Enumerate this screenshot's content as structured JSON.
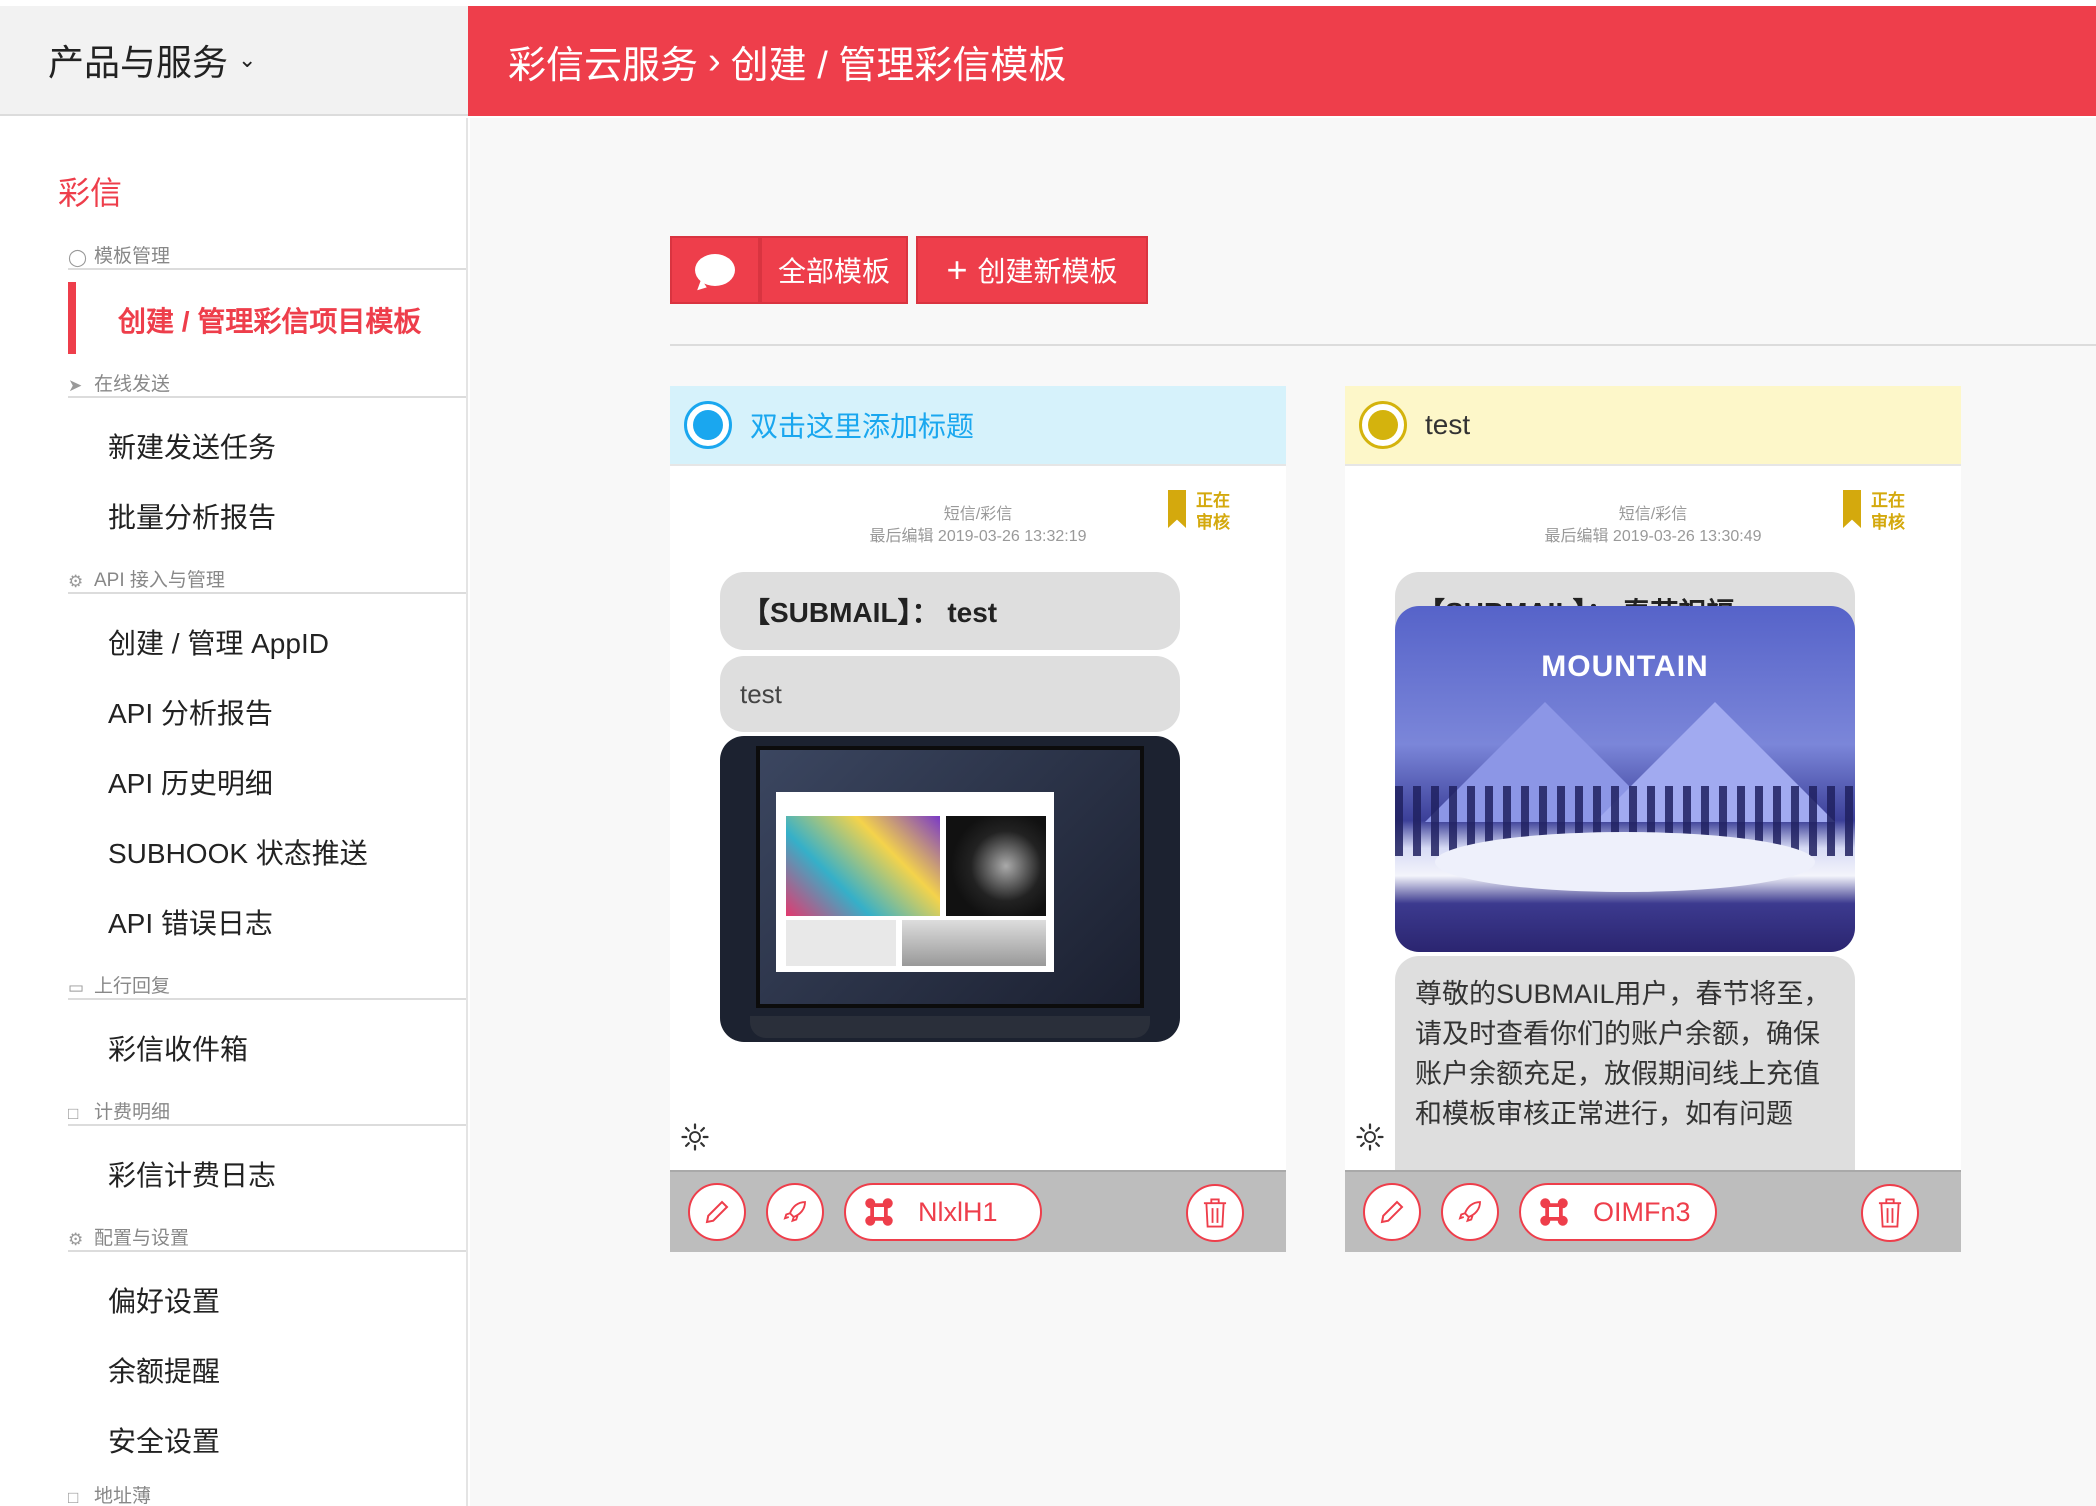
{
  "topbar": {
    "menu_label": "产品与服务",
    "breadcrumb_root": "彩信云服务",
    "breadcrumb_sep": "›",
    "breadcrumb_page": "创建 / 管理彩信模板"
  },
  "sidebar": {
    "title": "彩信",
    "sections": {
      "template": "模板管理",
      "online": "在线发送",
      "api": "API 接入与管理",
      "reply": "上行回复",
      "billing": "计费明细",
      "config": "配置与设置",
      "address": "地址薄"
    },
    "items": {
      "active_template": "创建 / 管理彩信项目模板",
      "new_task": "新建发送任务",
      "batch_report": "批量分析报告",
      "appid": "创建 / 管理 AppID",
      "api_report": "API 分析报告",
      "api_history": "API 历史明细",
      "subhook": "SUBHOOK 状态推送",
      "api_errors": "API 错误日志",
      "inbox": "彩信收件箱",
      "billing_log": "彩信计费日志",
      "prefs": "偏好设置",
      "balance_alert": "余额提醒",
      "security": "安全设置"
    }
  },
  "toolbar": {
    "all_templates": "全部模板",
    "create_template": "创建新模板",
    "plus": "+"
  },
  "cards": [
    {
      "title": "双击这里添加标题",
      "head_color": "#d6f2fb",
      "radio_color": "#1aa7ef",
      "title_color": "#1aa7ef",
      "type": "短信/彩信",
      "edited": "最后编辑 2019-03-26 13:32:19",
      "status_line1": "正在",
      "status_line2": "审核",
      "subject": "【SUBMAIL】： test",
      "text": "test",
      "image": "laptop-screenshot",
      "template_id": "NlxlH1"
    },
    {
      "title": "test",
      "head_color": "#fdf7c9",
      "radio_color": "#d4b30d",
      "title_color": "#333333",
      "type": "短信/彩信",
      "edited": "最后编辑 2019-03-26 13:30:49",
      "status_line1": "正在",
      "status_line2": "审核",
      "subject": "【SUBMAIL】： 春节祝福",
      "image_heading": "MOUNTAIN",
      "text": "尊敬的SUBMAIL用户，春节将至，请及时查看你们的账户余额，确保账户余额充足，放假期间线上充值和模板审核正常进行，如有问题",
      "template_id": "OIMFn3"
    }
  ],
  "colors": {
    "brand": "#ee3e4b",
    "pending": "#d4a90d"
  }
}
